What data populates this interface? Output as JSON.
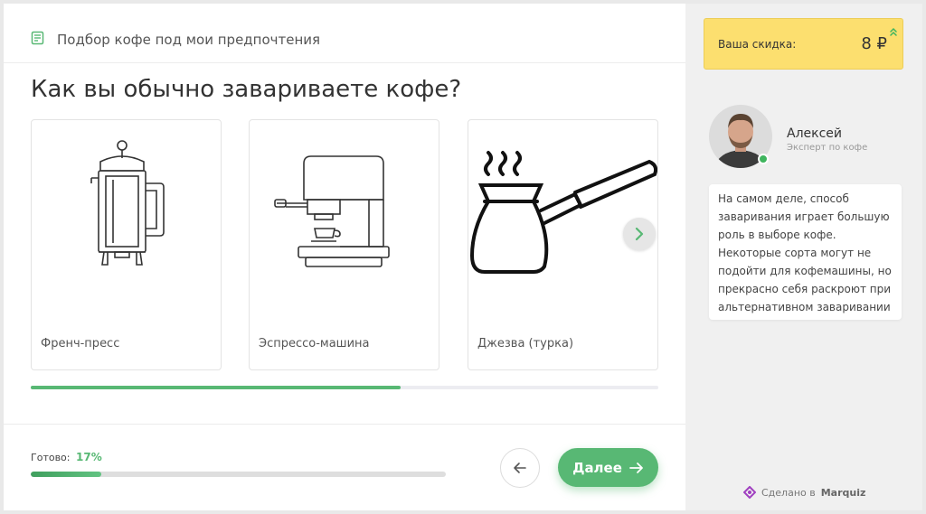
{
  "header": {
    "title": "Подбор кофе под мои предпочтения",
    "icon": "list-icon"
  },
  "question": "Как вы обычно завариваете кофе?",
  "options": [
    {
      "label": "Френч-пресс",
      "icon": "french-press"
    },
    {
      "label": "Эспрессо-машина",
      "icon": "espresso-machine"
    },
    {
      "label": "Джезва (турка)",
      "icon": "cezve"
    }
  ],
  "carousel_scroll": 0.59,
  "progress": {
    "label": "Готово:",
    "percent_text": "17%",
    "value": 0.17
  },
  "nav": {
    "next_label": "Далее"
  },
  "sidebar": {
    "discount_label": "Ваша скидка:",
    "discount_value": "8 ₽",
    "expert_name": "Алексей",
    "expert_role": "Эксперт по кофе",
    "message": "На самом деле, способ заваривания играет большую роль в выборе кофе. Некоторые сорта могут не подойти для кофемашины, но прекрасно себя раскроют при альтернативном заваривании",
    "made_in_prefix": "Сделано в",
    "made_in_brand": "Marquiz"
  },
  "colors": {
    "accent": "#58b874",
    "discount_bg": "#fcdf6f",
    "sidebar_bg": "#f0f0f0"
  }
}
